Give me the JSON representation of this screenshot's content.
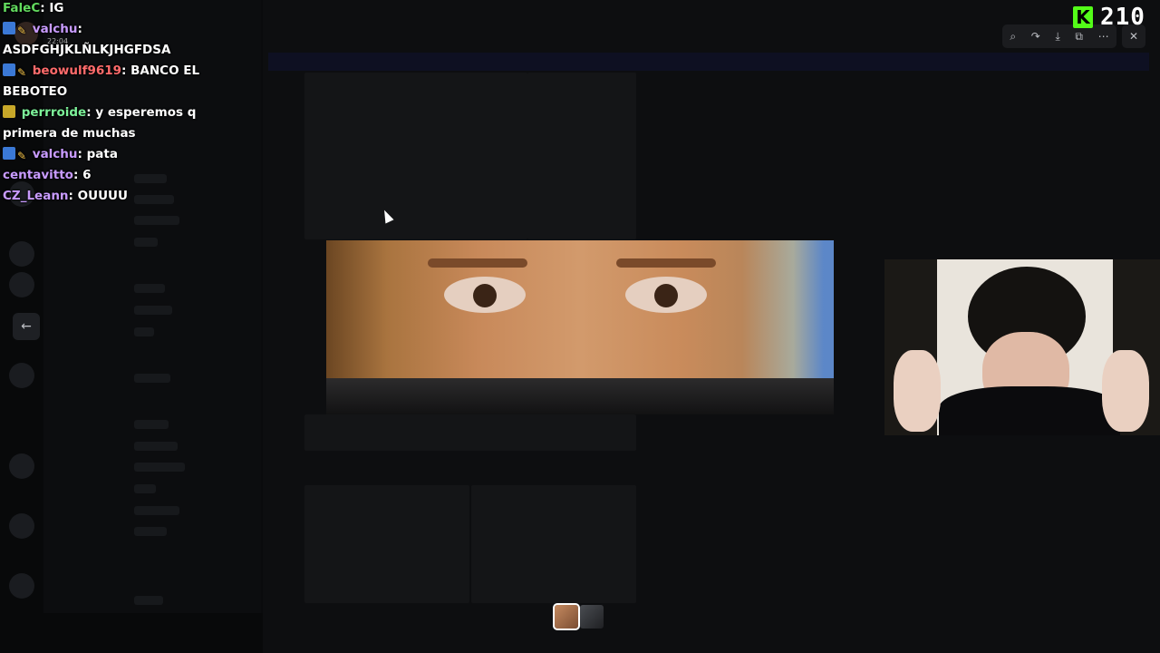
{
  "chat": [
    {
      "user": "FaleC",
      "user_color": "#62d95e",
      "text": "IG",
      "badges": []
    },
    {
      "user": "valchu",
      "user_color": "#c89bff",
      "text": "ASDFGHJKLÑLKJHGFDSA",
      "badges": [
        "blue",
        "pencil"
      ]
    },
    {
      "user": "beowulf9619",
      "user_color": "#ff6b6b",
      "text": "BANCO EL BEBOTEO",
      "badges": [
        "blue",
        "pencil"
      ]
    },
    {
      "user": "perrroide",
      "user_color": "#7df29a",
      "text": "y esperemos q primera de muchas",
      "badges": [
        "crown"
      ]
    },
    {
      "user": "valchu",
      "user_color": "#c89bff",
      "text": "pata",
      "badges": [
        "blue",
        "pencil"
      ]
    },
    {
      "user": "centavitto",
      "user_color": "#c89bff",
      "text": "6",
      "badges": []
    },
    {
      "user": "CZ_Leann",
      "user_color": "#c89bff",
      "text": "OUUUU",
      "badges": []
    }
  ],
  "chat_timestamp": "22:04",
  "follower_count": "210",
  "counter_icon": "K",
  "viewer": {
    "toolbar_icons": [
      "zoom-icon",
      "rotate-icon",
      "download-icon",
      "open-external-icon",
      "more-icon"
    ],
    "close_icon": "close-icon",
    "back_icon": "arrow-left-icon"
  },
  "colors": {
    "counter_accent": "#53fc18",
    "background": "#020203"
  }
}
